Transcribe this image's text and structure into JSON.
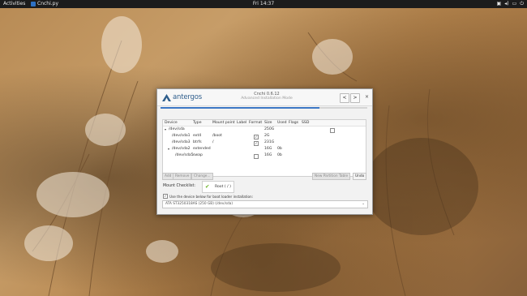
{
  "topbar": {
    "activities": "Activities",
    "app": "Cnchi.py",
    "clock": "Fri 14:37",
    "tray_icons": [
      "network-icon",
      "volume-icon",
      "battery-icon",
      "power-icon"
    ]
  },
  "window": {
    "logo_text": "antergos",
    "title": "Cnchi 0.6.12",
    "subtitle": "Advanced Installation Mode",
    "back_label": "<",
    "forward_label": ">",
    "close_label": "×",
    "progress": 0.77
  },
  "table": {
    "columns": [
      "Device",
      "Type",
      "Mount point",
      "Label",
      "Format",
      "Size",
      "Used",
      "Flags",
      "SSD"
    ],
    "rows": [
      {
        "expander": "▾",
        "device": "/dev/sda",
        "type": "",
        "mount": "",
        "format": "",
        "size": "250G",
        "used": "",
        "ssd_checkbox": true
      },
      {
        "expander": "",
        "device": "/dev/sda1",
        "type": "ext4",
        "mount": "/boot",
        "format": "✓",
        "size": "2G",
        "used": "",
        "ssd_checkbox": false
      },
      {
        "expander": "",
        "device": "/dev/sda3",
        "type": "btrfs",
        "mount": "/",
        "format": "✓",
        "size": "231G",
        "used": "",
        "ssd_checkbox": false
      },
      {
        "expander": "▾",
        "device": "/dev/sda2",
        "type": "extended",
        "mount": "",
        "format": "",
        "size": "16G",
        "used": "0b",
        "ssd_checkbox": false
      },
      {
        "expander": "",
        "device": "/dev/sda5",
        "type": "swap",
        "mount": "",
        "format": "☐",
        "size": "16G",
        "used": "0b",
        "ssd_checkbox": false
      }
    ]
  },
  "buttons": {
    "add": "Add",
    "remove": "Remove",
    "change": "Change...",
    "new_table": "New Partition Table",
    "undo": "Undo"
  },
  "mount_check": {
    "label": "Mount Checklist:",
    "item": "Root ( / )"
  },
  "bootloader": {
    "label": "Use the device below for boot loader installation:",
    "device": "ATA ST3250318AS (250 GB) (/dev/sda)"
  },
  "colors": {
    "accent": "#3d78c5",
    "ok": "#6ab022",
    "topbar": "#1c1c1c"
  }
}
